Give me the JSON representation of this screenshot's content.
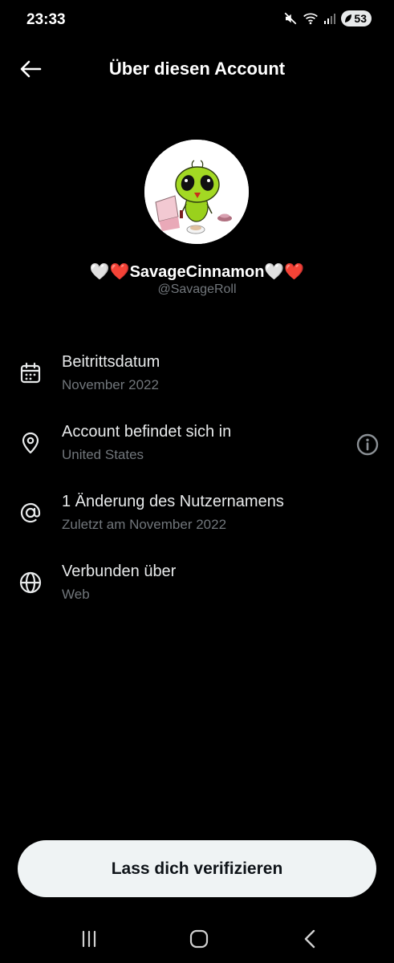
{
  "status": {
    "time": "23:33",
    "battery": "53"
  },
  "header": {
    "title": "Über diesen Account"
  },
  "profile": {
    "display_name": "🤍❤️SavageCinnamon🤍❤️",
    "handle": "@SavageRoll"
  },
  "rows": [
    {
      "icon": "calendar-icon",
      "title": "Beitrittsdatum",
      "subtitle": "November 2022"
    },
    {
      "icon": "location-pin-icon",
      "title": "Account befindet sich in",
      "subtitle": "United States"
    },
    {
      "icon": "at-sign-icon",
      "title": "1 Änderung des Nutzernamens",
      "subtitle": "Zuletzt am November 2022"
    },
    {
      "icon": "globe-icon",
      "title": "Verbunden über",
      "subtitle": "Web"
    }
  ],
  "verify_button": {
    "label": "Lass dich verifizieren"
  },
  "colors": {
    "background": "#000000",
    "text": "#e7e9ea",
    "muted": "#71767b",
    "button": "#eff3f4"
  }
}
